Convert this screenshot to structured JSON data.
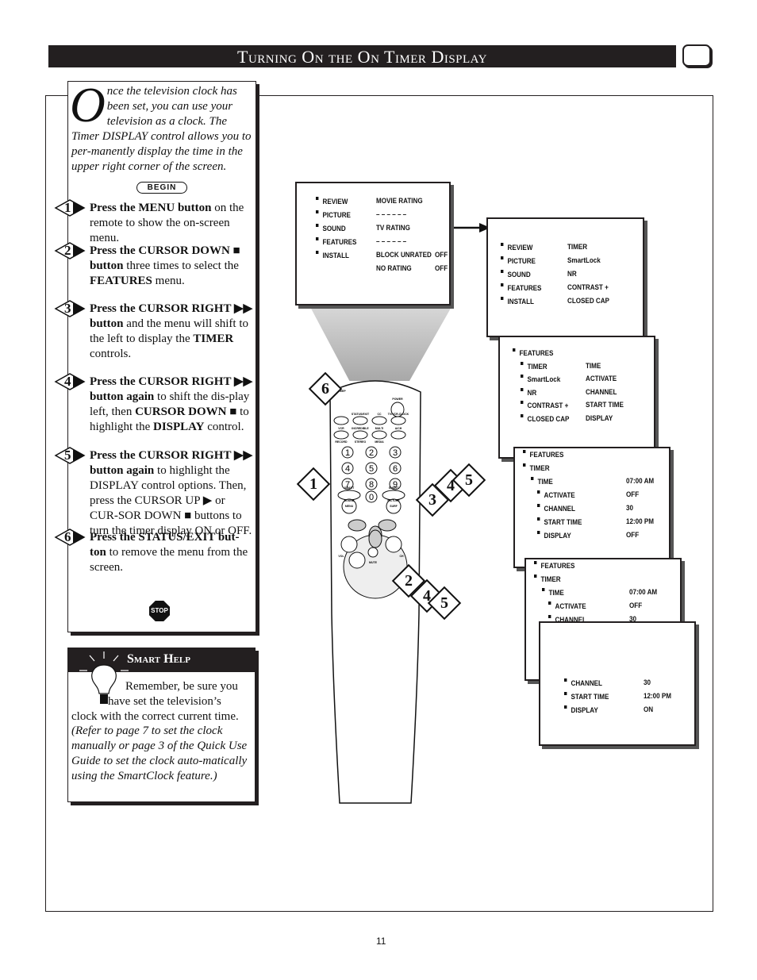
{
  "header": {
    "title": "Turning On the On Timer Display",
    "icon": "tv-icon"
  },
  "intro": {
    "dropcap": "O",
    "text": "nce the television clock has been set, you can use your television as a clock. The Timer DISPLAY control allows you to per-manently display the time in the upper right corner of the screen.",
    "begin_label": "BEGIN"
  },
  "steps": [
    {
      "num": "1",
      "segments": [
        {
          "t": "Press the MENU button",
          "b": true
        },
        {
          "t": " on the remote to show the on-screen menu."
        }
      ]
    },
    {
      "num": "2",
      "segments": [
        {
          "t": "Press the CURSOR DOWN ■ button",
          "b": true
        },
        {
          "t": " three times to select the "
        },
        {
          "t": "FEATURES",
          "b": true
        },
        {
          "t": " menu."
        }
      ]
    },
    {
      "num": "3",
      "segments": [
        {
          "t": "Press the CURSOR RIGHT ▶▶ button",
          "b": true
        },
        {
          "t": " and the menu will shift to the left to display the "
        },
        {
          "t": "TIMER",
          "b": true
        },
        {
          "t": " controls."
        }
      ]
    },
    {
      "num": "4",
      "segments": [
        {
          "t": "Press the CURSOR RIGHT ▶▶ button again",
          "b": true
        },
        {
          "t": " to shift the dis-play left, then "
        },
        {
          "t": "CURSOR DOWN ■",
          "b": true
        },
        {
          "t": " to highlight the "
        },
        {
          "t": "DISPLAY",
          "b": true
        },
        {
          "t": " control."
        }
      ]
    },
    {
      "num": "5",
      "segments": [
        {
          "t": "Press the CURSOR RIGHT ▶▶ button again",
          "b": true
        },
        {
          "t": " to highlight the DISPLAY control options. Then, press the CURSOR UP ▶ or CUR-SOR DOWN ■ buttons to turn the timer display ON or OFF."
        }
      ]
    },
    {
      "num": "6",
      "segments": [
        {
          "t": "Press the STATUS/EXIT but-ton",
          "b": true
        },
        {
          "t": " to remove the menu from the screen."
        }
      ]
    }
  ],
  "stop_label": "STOP",
  "smart_help": {
    "title": "Smart Help",
    "line1": "Remember, be sure you",
    "line2": "have set the television’s",
    "line3": "clock with the correct current time.",
    "note": "(Refer to page 7 to set the clock manually or page 3 of the Quick Use Guide to set the clock auto-matically using the SmartClock feature.)"
  },
  "menus": [
    {
      "rows": [
        [
          "REVIEW",
          "MOVIE RATING",
          ""
        ],
        [
          "PICTURE",
          "– – – – – –",
          ""
        ],
        [
          "SOUND",
          "TV RATING",
          ""
        ],
        [
          "FEATURES",
          "– – – – – –",
          ""
        ],
        [
          "INSTALL",
          "BLOCK UNRATED",
          "OFF"
        ],
        [
          "",
          "NO RATING",
          "OFF"
        ]
      ]
    },
    {
      "rows": [
        [
          "REVIEW",
          "TIMER"
        ],
        [
          "PICTURE",
          "SmartLock"
        ],
        [
          "SOUND",
          "NR"
        ],
        [
          "FEATURES",
          "CONTRAST +"
        ],
        [
          "INSTALL",
          "CLOSED CAP"
        ]
      ]
    },
    {
      "rows": [
        [
          "FEATURES",
          ""
        ],
        [
          "TIMER",
          "TIME"
        ],
        [
          "SmartLock",
          "ACTIVATE"
        ],
        [
          "NR",
          "CHANNEL"
        ],
        [
          "CONTRAST +",
          "START TIME"
        ],
        [
          "CLOSED CAP",
          "DISPLAY"
        ]
      ]
    },
    {
      "rows": [
        [
          "FEATURES",
          ""
        ],
        [
          "TIMER",
          ""
        ],
        [
          "TIME",
          "07:00 AM"
        ],
        [
          "ACTIVATE",
          "OFF"
        ],
        [
          "CHANNEL",
          "30"
        ],
        [
          "START TIME",
          "12:00 PM"
        ],
        [
          "DISPLAY",
          "OFF"
        ]
      ]
    },
    {
      "rows": [
        [
          "FEATURES",
          ""
        ],
        [
          "TIMER",
          ""
        ],
        [
          "TIME",
          "07:00 AM"
        ],
        [
          "ACTIVATE",
          "OFF"
        ],
        [
          "CHANNEL",
          "30"
        ],
        [
          "START TIME",
          "12:00 PM"
        ],
        [
          "DISPLAY",
          "OFF"
        ]
      ]
    },
    {
      "rows": [
        [
          "CHANNEL",
          "30"
        ],
        [
          "START TIME",
          "12:00 PM"
        ],
        [
          "DISPLAY",
          "ON"
        ]
      ]
    }
  ],
  "remote": {
    "buttons": [
      "POWER",
      "SLEEP",
      "STATUS/EXIT",
      "CC",
      "TV/VCR-CLOCK",
      "VCR",
      "INCREDIBLE",
      "MULTI",
      "A/CH",
      "RECORD",
      "STEREO",
      "MEDIA",
      "SMART",
      "SOUND",
      "SMART",
      "PICTURE",
      "MENU",
      "SURF",
      "VOL",
      "CH",
      "MUTE"
    ],
    "keys": [
      "1",
      "2",
      "3",
      "4",
      "5",
      "6",
      "7",
      "8",
      "9",
      "0"
    ],
    "badges": [
      "6",
      "1",
      "3",
      "4",
      "5",
      "2",
      "4",
      "5"
    ]
  },
  "page_number": "11"
}
